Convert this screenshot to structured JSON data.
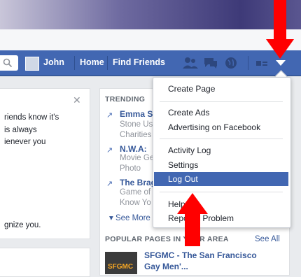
{
  "navbar": {
    "user_name": "John",
    "home_label": "Home",
    "find_friends_label": "Find Friends"
  },
  "left_panel": {
    "lines": [
      "riends know it's",
      "is always",
      "ienever you"
    ],
    "bottom_line": "gnize you."
  },
  "trending": {
    "header": "TRENDING",
    "items": [
      {
        "title": "Emma S",
        "desc_lines": [
          "Stone Us",
          "Charities"
        ]
      },
      {
        "title": "N.W.A:",
        "title_suffix": "N",
        "desc_lines": [
          "Movie Ge",
          "Photo"
        ]
      },
      {
        "title": "The Brag",
        "desc_lines": [
          "Game of",
          "Know Yo"
        ]
      }
    ],
    "see_more": "See More"
  },
  "popular_pages": {
    "header": "POPULAR PAGES IN YOUR AREA",
    "see_all": "See All",
    "page": {
      "title_line1": "SFGMC - The San Francisco",
      "title_line2": "Gay Men'...",
      "logo_text": "SFGMC"
    }
  },
  "account_menu": {
    "items": [
      {
        "label": "Create Page"
      },
      {
        "label": "Create Ads"
      },
      {
        "label": "Advertising on Facebook"
      },
      {
        "label": "Activity Log"
      },
      {
        "label": "Settings"
      },
      {
        "label": "Log Out",
        "highlighted": true
      },
      {
        "label": "Help"
      },
      {
        "label": "Report a Problem"
      }
    ]
  },
  "colors": {
    "facebook_blue": "#4267b2",
    "link_blue": "#365899",
    "annotation_arrow": "#ff0000"
  },
  "icons": [
    "search-icon",
    "friends-icon",
    "messages-icon",
    "globe-icon",
    "privacy-icon",
    "dropdown-caret-icon",
    "trending-arrow-icon",
    "close-icon"
  ]
}
